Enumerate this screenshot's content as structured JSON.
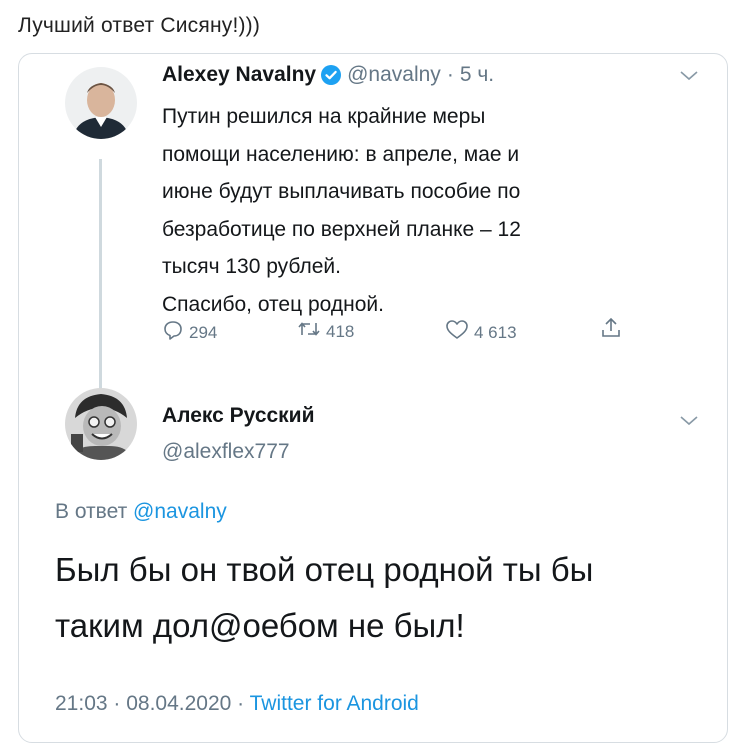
{
  "caption": "Лучший ответ Сисяну!)))",
  "original_tweet": {
    "name": "Alexey Navalny",
    "handle": "@navalny",
    "separator": "·",
    "time": "5 ч.",
    "lines": [
      "Путин решился на крайние меры",
      "помощи населению: в апреле, мае и",
      "июне будут выплачивать пособие по",
      "безработице по верхней планке – 12",
      "тысяч 130 рублей.",
      "Спасибо, отец родной."
    ],
    "replies": "294",
    "retweets": "418",
    "likes": "4 613"
  },
  "reply_tweet": {
    "name": "Алекс Русский",
    "handle": "@alexflex777",
    "in_reply_prefix": "В ответ",
    "in_reply_handle": "@navalny",
    "lines": [
      "Был бы он твой отец родной ты бы",
      "таким дол@оебом не был!"
    ],
    "timestamp": "21:03 · 08.04.2020 ·",
    "source": "Twitter for Android"
  },
  "colors": {
    "link": "#1b95e0",
    "muted": "#657786",
    "border": "#d7dde2",
    "verified": "#1da1f2"
  }
}
